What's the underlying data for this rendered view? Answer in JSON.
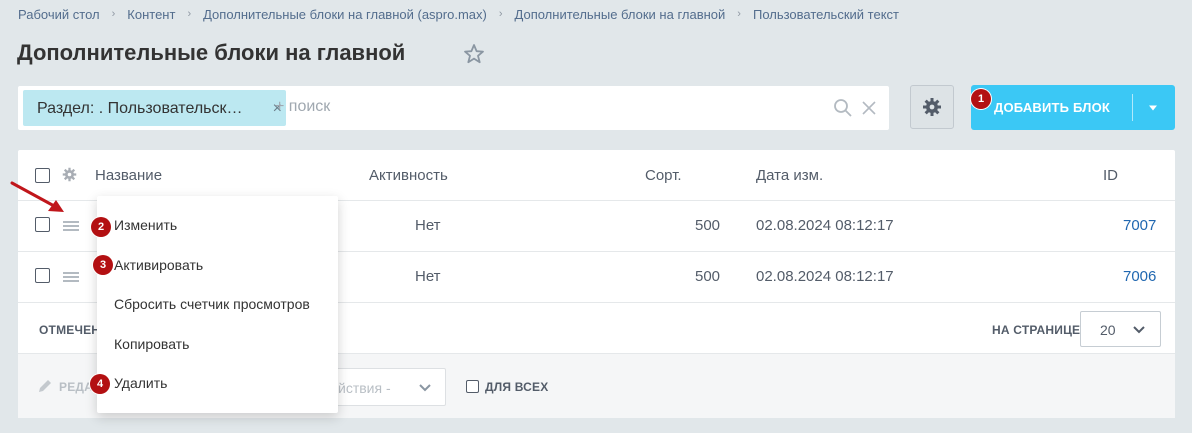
{
  "breadcrumbs": [
    "Рабочий стол",
    "Контент",
    "Дополнительные блоки на главной (aspro.max)",
    "Дополнительные блоки на главной",
    "Пользовательский текст"
  ],
  "page_title": "Дополнительные блоки на главной",
  "filter": {
    "tag_label": "Раздел: . Пользовательский текст",
    "tag_close": "×",
    "search_placeholder": "+ поиск"
  },
  "toolbar": {
    "add_label": "ДОБАВИТЬ БЛОК"
  },
  "badges": [
    "1",
    "2",
    "3",
    "4"
  ],
  "grid": {
    "columns": {
      "name": "Название",
      "active": "Активность",
      "sort": "Сорт.",
      "date": "Дата изм.",
      "id": "ID"
    },
    "rows": [
      {
        "active": "Нет",
        "sort": "500",
        "date": "02.08.2024 08:12:17",
        "id": "7007"
      },
      {
        "active": "Нет",
        "sort": "500",
        "date": "02.08.2024 08:12:17",
        "id": "7006"
      }
    ],
    "footer": {
      "selected_label": "ОТМЕЧЕН",
      "per_page_label": "НА СТРАНИЦЕ:",
      "per_page_value": "20",
      "edit_label": "РЕДА",
      "actions_label": "йствия -",
      "for_all_label": "ДЛЯ ВСЕХ"
    }
  },
  "context_menu": {
    "items": [
      "Изменить",
      "Активировать",
      "Сбросить счетчик просмотров",
      "Копировать",
      "Удалить"
    ]
  },
  "colors": {
    "accent": "#3bc8f5",
    "badge": "#b31012",
    "link": "#2067b0",
    "tag": "#bce8f1"
  },
  "icons": [
    "star-icon",
    "magnifier-icon",
    "clear-icon",
    "gear-icon",
    "chevron-down-icon",
    "drag-handle-icon",
    "pencil-icon",
    "arrow-annotation-icon"
  ]
}
